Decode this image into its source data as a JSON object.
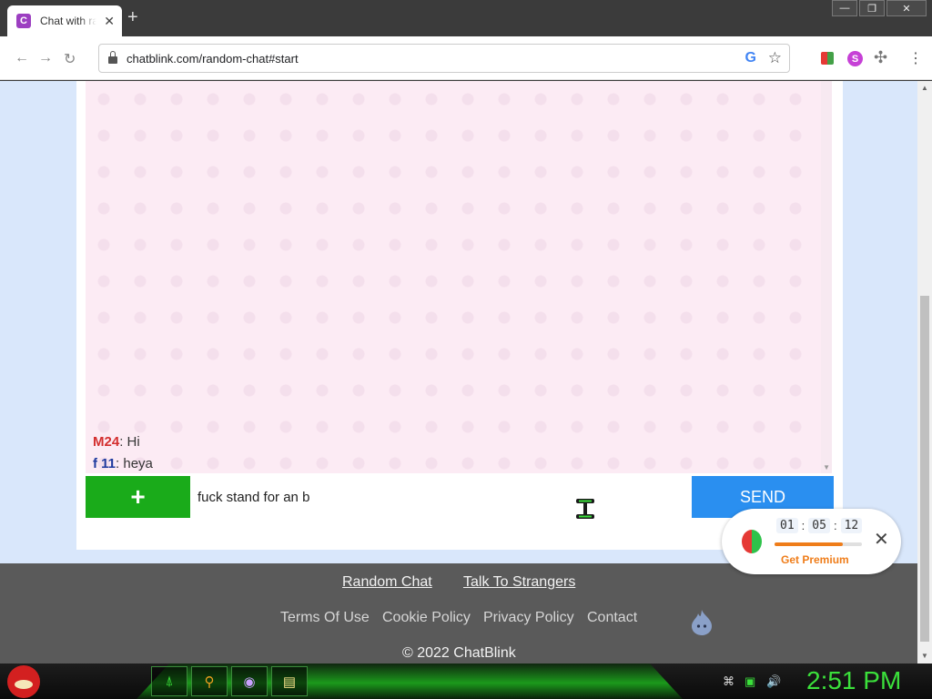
{
  "browser": {
    "tab_title": "Chat with random strangers",
    "tab_favicon_letter": "C",
    "url": "chatblink.com/random-chat#start",
    "new_tab": "+",
    "ext_s_label": "S"
  },
  "chat": {
    "messages": [
      {
        "nick": "M24",
        "sep": ": ",
        "text": "Hi"
      },
      {
        "nick": "f 11",
        "sep": ": ",
        "text": "heya"
      }
    ],
    "input_value": "fuck stand for an b",
    "plus_label": "+",
    "send_label": "SEND"
  },
  "footer": {
    "links_top": [
      "Random Chat",
      "Talk To Strangers"
    ],
    "links_bottom": [
      "Terms Of Use",
      "Cookie Policy",
      "Privacy Policy",
      "Contact"
    ],
    "copyright": "© 2022 ChatBlink"
  },
  "premium_widget": {
    "timer": [
      "01",
      "05",
      "12"
    ],
    "progress": 0.78,
    "cta": "Get Premium",
    "close": "✕"
  },
  "taskbar": {
    "clock": "2:51 PM",
    "apps": [
      "terminal-icon",
      "search-icon",
      "media-icon",
      "files-icon"
    ]
  },
  "colors": {
    "send": "#2a8ff0",
    "plus": "#1aab1a",
    "footer": "#5a5a5a",
    "premium_accent": "#ef7d1a",
    "clock": "#3be03b"
  }
}
